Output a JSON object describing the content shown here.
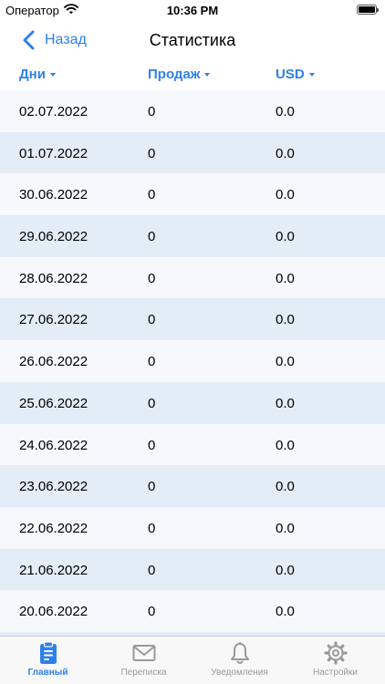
{
  "status_bar": {
    "carrier": "Оператор",
    "time": "10:36 PM",
    "battery_level": 1.0
  },
  "nav": {
    "back_label": "Назад",
    "title": "Статистика"
  },
  "columns": [
    {
      "label": "Дни"
    },
    {
      "label": "Продаж"
    },
    {
      "label": "USD"
    }
  ],
  "rows": [
    {
      "date": "02.07.2022",
      "sales": "0",
      "usd": "0.0"
    },
    {
      "date": "01.07.2022",
      "sales": "0",
      "usd": "0.0"
    },
    {
      "date": "30.06.2022",
      "sales": "0",
      "usd": "0.0"
    },
    {
      "date": "29.06.2022",
      "sales": "0",
      "usd": "0.0"
    },
    {
      "date": "28.06.2022",
      "sales": "0",
      "usd": "0.0"
    },
    {
      "date": "27.06.2022",
      "sales": "0",
      "usd": "0.0"
    },
    {
      "date": "26.06.2022",
      "sales": "0",
      "usd": "0.0"
    },
    {
      "date": "25.06.2022",
      "sales": "0",
      "usd": "0.0"
    },
    {
      "date": "24.06.2022",
      "sales": "0",
      "usd": "0.0"
    },
    {
      "date": "23.06.2022",
      "sales": "0",
      "usd": "0.0"
    },
    {
      "date": "22.06.2022",
      "sales": "0",
      "usd": "0.0"
    },
    {
      "date": "21.06.2022",
      "sales": "0",
      "usd": "0.0"
    },
    {
      "date": "20.06.2022",
      "sales": "0",
      "usd": "0.0"
    },
    {
      "date": "",
      "sales": "",
      "usd": ""
    }
  ],
  "tabs": [
    {
      "label": "Главный",
      "icon": "clipboard-icon",
      "active": true
    },
    {
      "label": "Переписка",
      "icon": "envelope-icon",
      "active": false
    },
    {
      "label": "Уведомления",
      "icon": "bell-icon",
      "active": false
    },
    {
      "label": "Настройки",
      "icon": "gear-icon",
      "active": false
    }
  ],
  "colors": {
    "accent": "#2f80ed",
    "row_odd": "#f7f8fc",
    "row_even": "#e3edf8",
    "tab_inactive": "#9a9a9a"
  }
}
